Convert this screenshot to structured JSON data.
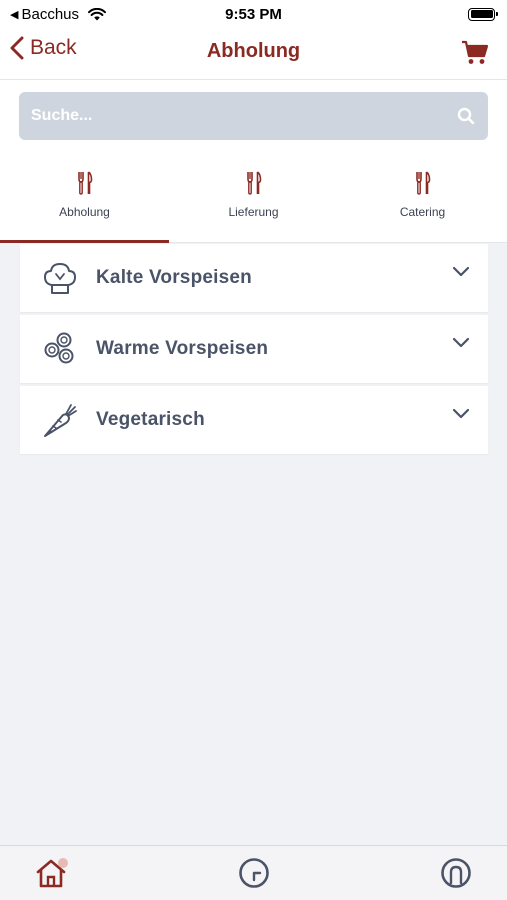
{
  "status_bar": {
    "carrier": "Bacchus",
    "time": "9:53 PM"
  },
  "nav": {
    "back_label": "Back",
    "title": "Abholung"
  },
  "search": {
    "placeholder": "Suche..."
  },
  "tabs": [
    {
      "label": "Abholung",
      "icon": "utensils-icon",
      "active": true
    },
    {
      "label": "Lieferung",
      "icon": "utensils-icon",
      "active": false
    },
    {
      "label": "Catering",
      "icon": "utensils-icon",
      "active": false
    }
  ],
  "categories": [
    {
      "label": "Kalte Vorspeisen",
      "icon": "chef-hat-icon"
    },
    {
      "label": "Warme Vorspeisen",
      "icon": "circles-icon"
    },
    {
      "label": "Vegetarisch",
      "icon": "carrot-icon"
    }
  ],
  "bottom_bar": {
    "items": [
      "home-icon",
      "clock-icon",
      "profile-icon"
    ]
  },
  "colors": {
    "accent": "#8b2a22",
    "background": "#f1f2f5",
    "search_bg": "#cfd5df",
    "text_dark": "#4a5368"
  }
}
